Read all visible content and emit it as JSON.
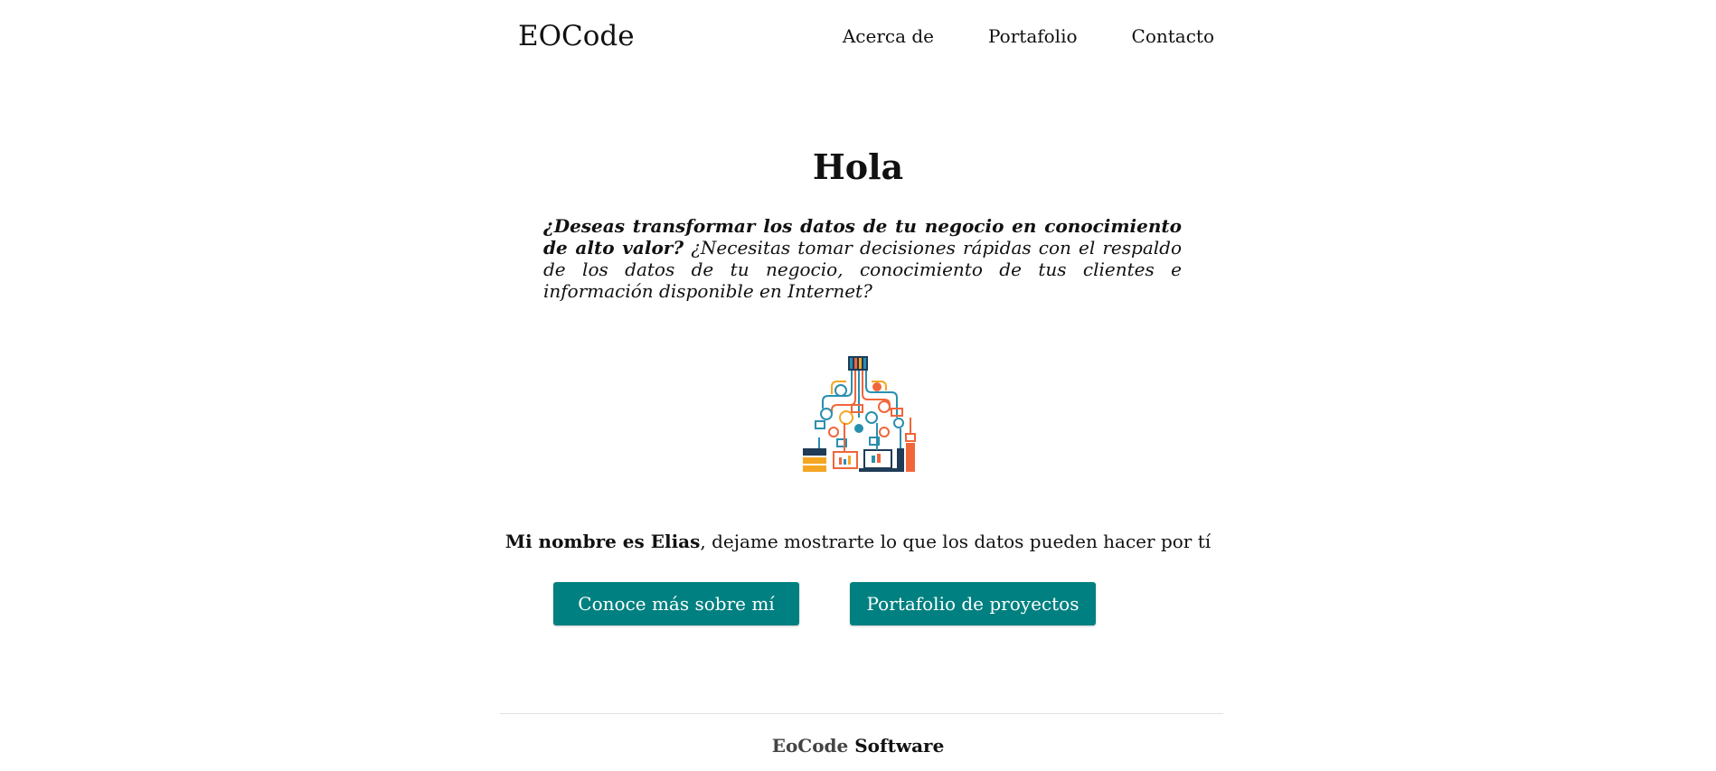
{
  "header": {
    "brand": "EOCode",
    "nav": [
      {
        "label": "Acerca de"
      },
      {
        "label": "Portafolio"
      },
      {
        "label": "Contacto"
      }
    ]
  },
  "hero": {
    "title": "Hola",
    "intro_bold": "¿Deseas transformar los datos de tu negocio en conocimiento de alto valor?",
    "intro_rest": " ¿Necesitas tomar decisiones rápidas con el respaldo de los datos de tu negocio, conocimiento de tus clientes e información disponible en Internet?"
  },
  "tagline": {
    "bold": "Mi nombre es Elias",
    "rest": ", dejame mostrarte lo que los datos pueden hacer por tí"
  },
  "buttons": {
    "about": "Conoce más sobre mí",
    "portfolio": "Portafolio de proyectos"
  },
  "footer": {
    "part1": "EoCode",
    "part2": "Software"
  },
  "colors": {
    "accent": "#008080",
    "illustration_teal": "#2a8fae",
    "illustration_orange": "#f0663a",
    "illustration_yellow": "#f5a623",
    "illustration_navy": "#1f3b57"
  },
  "illustration": {
    "icon": "data-network-illustration"
  }
}
